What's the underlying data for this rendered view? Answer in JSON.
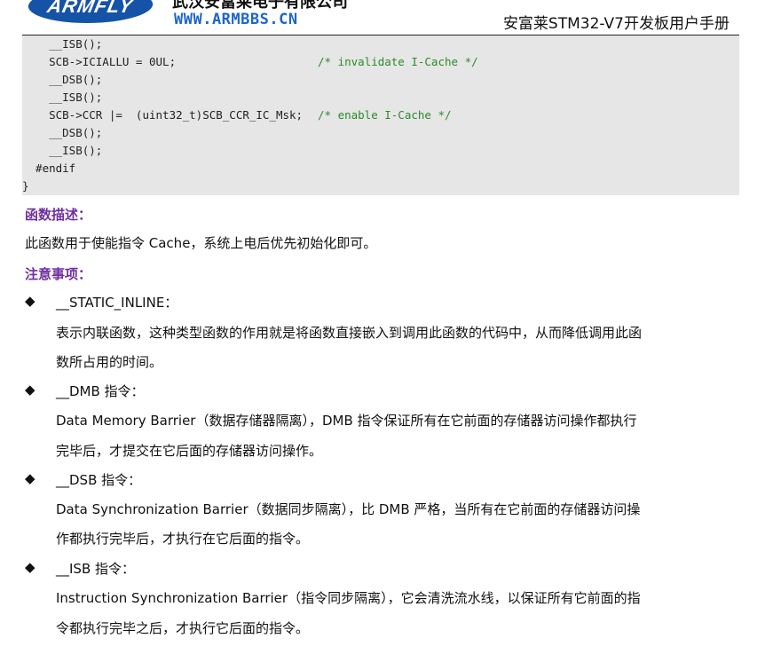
{
  "header": {
    "logo_text": "ARMFLY",
    "company": "武汉安富莱电子有限公司",
    "website": "WWW.ARMBBS.CN",
    "manual_title": "安富莱STM32-V7开发板用户手册"
  },
  "code": {
    "lines": [
      {
        "code": "    __ISB();",
        "comment": ""
      },
      {
        "code": "    SCB->ICIALLU = 0UL;",
        "comment": "/* invalidate I-Cache */"
      },
      {
        "code": "    __DSB();",
        "comment": ""
      },
      {
        "code": "    __ISB();",
        "comment": ""
      },
      {
        "code": "    SCB->CCR |=  (uint32_t)SCB_CCR_IC_Msk;",
        "comment": "/* enable I-Cache */"
      },
      {
        "code": "    __DSB();",
        "comment": ""
      },
      {
        "code": "    __ISB();",
        "comment": ""
      },
      {
        "code": "  #endif",
        "comment": ""
      },
      {
        "code": "}",
        "comment": ""
      }
    ]
  },
  "section_desc": {
    "heading": "函数描述：",
    "text": "此函数用于使能指令 Cache，系统上电后优先初始化即可。"
  },
  "section_notes": {
    "heading": "注意事项：",
    "bullet_glyph": "◆",
    "items": [
      {
        "title": "__STATIC_INLINE：",
        "lines": [
          "表示内联函数，这种类型函数的作用就是将函数直接嵌入到调用此函数的代码中，从而降低调用此函",
          "数所占用的时间。"
        ]
      },
      {
        "title": "__DMB 指令：",
        "lines": [
          "Data Memory Barrier（数据存储器隔离），DMB 指令保证所有在它前面的存储器访问操作都执行",
          "完毕后，才提交在它后面的存储器访问操作。"
        ]
      },
      {
        "title": "__DSB 指令：",
        "lines": [
          "Data Synchronization Barrier（数据同步隔离），比 DMB 严格，当所有在它前面的存储器访问操",
          "作都执行完毕后，才执行在它后面的指令。"
        ]
      },
      {
        "title": "__ISB 指令：",
        "lines": [
          "Instruction Synchronization Barrier（指令同步隔离），它会清洗流水线，以保证所有它前面的指",
          "令都执行完毕之后，才执行它后面的指令。"
        ]
      }
    ]
  }
}
